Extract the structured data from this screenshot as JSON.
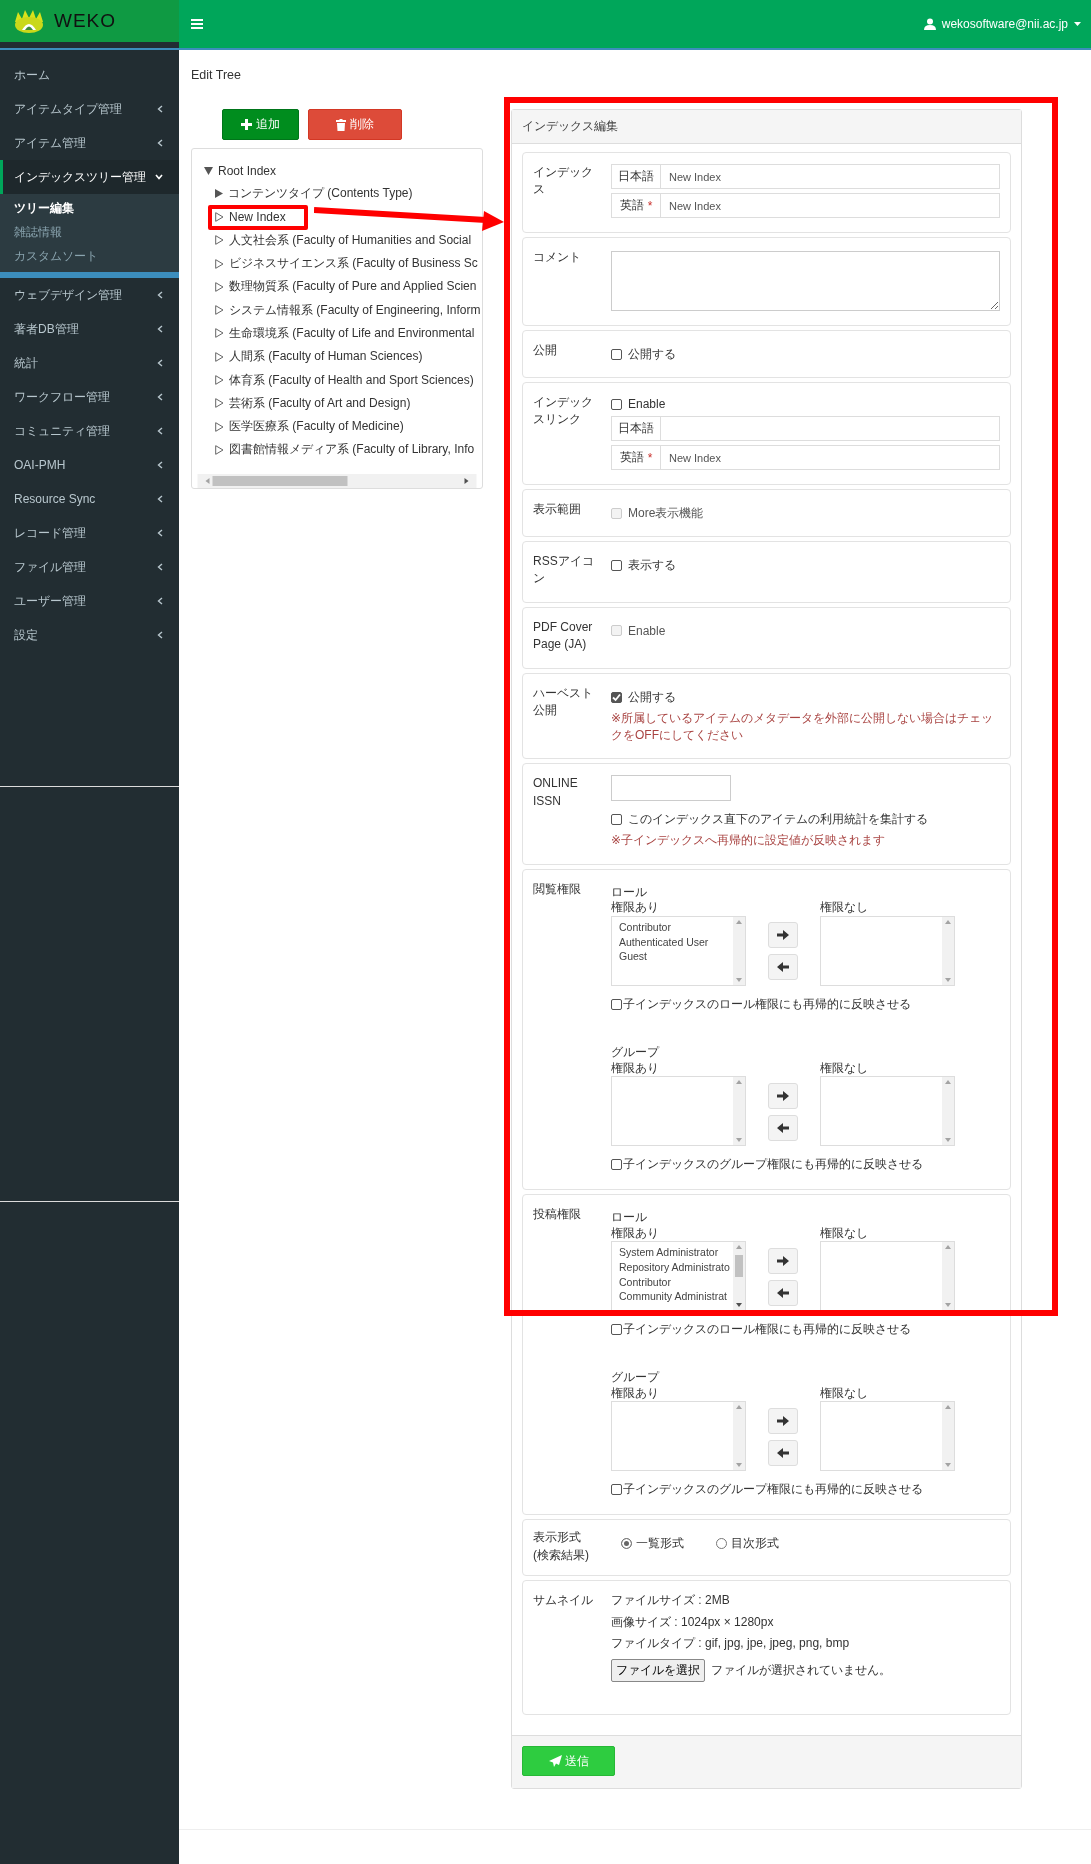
{
  "header": {
    "logo_text": "WEKO",
    "user": "wekosoftware@nii.ac.jp"
  },
  "sidebar": {
    "items": [
      {
        "label": "ホーム",
        "kind": "link"
      },
      {
        "label": "アイテムタイプ管理",
        "kind": "menu",
        "expanded": false
      },
      {
        "label": "アイテム管理",
        "kind": "menu",
        "expanded": false
      },
      {
        "label": "インデックスツリー管理",
        "kind": "menu",
        "expanded": true,
        "children": [
          {
            "label": "ツリー編集",
            "selected": true
          },
          {
            "label": "雑誌情報",
            "selected": false
          },
          {
            "label": "カスタムソート",
            "selected": false
          }
        ]
      },
      {
        "label": "ウェブデザイン管理",
        "kind": "menu",
        "expanded": false
      },
      {
        "label": "著者DB管理",
        "kind": "menu",
        "expanded": false
      },
      {
        "label": "統計",
        "kind": "menu",
        "expanded": false
      },
      {
        "label": "ワークフロー管理",
        "kind": "menu",
        "expanded": false
      },
      {
        "label": "コミュニティ管理",
        "kind": "menu",
        "expanded": false
      },
      {
        "label": "OAI-PMH",
        "kind": "menu",
        "expanded": false
      },
      {
        "label": "Resource Sync",
        "kind": "menu",
        "expanded": false
      },
      {
        "label": "レコード管理",
        "kind": "menu",
        "expanded": false
      },
      {
        "label": "ファイル管理",
        "kind": "menu",
        "expanded": false
      },
      {
        "label": "ユーザー管理",
        "kind": "menu",
        "expanded": false
      },
      {
        "label": "設定",
        "kind": "menu",
        "expanded": false
      }
    ]
  },
  "page_title": "Edit Tree",
  "tree_buttons": [
    {
      "label": "追加",
      "kind": "add"
    },
    {
      "label": "削除",
      "kind": "delete"
    }
  ],
  "tree": {
    "root": {
      "label": "Root Index",
      "expanded": true,
      "children": [
        {
          "label": "コンテンツタイプ (Contents Type)",
          "kind": "folder",
          "highlighted": false
        },
        {
          "label": "New Index",
          "kind": "leaf",
          "highlighted": true
        },
        {
          "label": "人文社会系 (Faculty of Humanities and Social",
          "kind": "leaf",
          "highlighted": false
        },
        {
          "label": "ビジネスサイエンス系 (Faculty of Business Sc",
          "kind": "leaf",
          "highlighted": false
        },
        {
          "label": "数理物質系 (Faculty of Pure and Applied Scien",
          "kind": "leaf",
          "highlighted": false
        },
        {
          "label": "システム情報系 (Faculty of Engineering, Inform",
          "kind": "leaf",
          "highlighted": false
        },
        {
          "label": "生命環境系 (Faculty of Life and Environmental",
          "kind": "leaf",
          "highlighted": false
        },
        {
          "label": "人間系 (Faculty of Human Sciences)",
          "kind": "leaf",
          "highlighted": false
        },
        {
          "label": "体育系 (Faculty of Health and Sport Sciences)",
          "kind": "leaf",
          "highlighted": false
        },
        {
          "label": "芸術系 (Faculty of Art and Design)",
          "kind": "leaf",
          "highlighted": false
        },
        {
          "label": "医学医療系 (Faculty of Medicine)",
          "kind": "leaf",
          "highlighted": false
        },
        {
          "label": "図書館情報メディア系 (Faculty of Library, Info",
          "kind": "leaf",
          "highlighted": false
        }
      ]
    }
  },
  "index_edit": {
    "title": "インデックス編集",
    "highlighted": true,
    "sections": [
      {
        "kind": "names",
        "label": "インデックス",
        "fields": [
          {
            "lang": "日本語",
            "value": "New Index"
          },
          {
            "lang": "英語",
            "required_mark": "*",
            "value": "New Index"
          }
        ]
      },
      {
        "kind": "textarea",
        "label": "コメント"
      },
      {
        "kind": "checkbox",
        "label": "公開",
        "options": [
          {
            "text": "公開する",
            "checked": false,
            "disabled": false
          }
        ]
      },
      {
        "kind": "link",
        "label": "インデックスリンク",
        "option": {
          "text": "Enable",
          "checked": false,
          "disabled": false
        },
        "fields": [
          {
            "lang": "日本語"
          },
          {
            "lang": "英語",
            "required_mark": "*",
            "value": "New Index"
          }
        ]
      },
      {
        "kind": "checkbox",
        "label": "表示範囲",
        "options": [
          {
            "text": "More表示機能",
            "checked": false,
            "disabled": true
          }
        ]
      },
      {
        "kind": "checkbox",
        "label": "RSSアイコン",
        "options": [
          {
            "text": "表示する",
            "checked": false,
            "disabled": false
          }
        ]
      },
      {
        "kind": "checkbox",
        "label": "PDF Cover Page (JA)",
        "options": [
          {
            "text": "Enable",
            "checked": false,
            "disabled": true
          }
        ]
      },
      {
        "kind": "checkbox",
        "label": "ハーベスト公開",
        "options": [
          {
            "text": "公開する",
            "checked": true,
            "disabled": false
          }
        ],
        "note": "※所属しているアイテムのメタデータを外部に公開しない場合はチェックをOFFにしてください"
      },
      {
        "kind": "issn",
        "label": "ONLINE ISSN",
        "option": {
          "text": "このインデックス直下のアイテムの利用統計を集計する",
          "checked": false,
          "disabled": false
        },
        "note": "※子インデックスへ再帰的に設定値が反映されます"
      },
      {
        "kind": "permissions",
        "label": "閲覧権限",
        "groups": [
          {
            "title": "ロール",
            "allowed_label": "権限あり",
            "denied_label": "権限なし",
            "allowed": [
              "Contributor",
              "Authenticated User",
              "Guest"
            ],
            "recursive": {
              "text": "子インデックスのロール権限にも再帰的に反映させる",
              "checked": false,
              "disabled": false
            }
          },
          {
            "title": "グループ",
            "allowed_label": "権限あり",
            "denied_label": "権限なし",
            "recursive": {
              "text": "子インデックスのグループ権限にも再帰的に反映させる",
              "checked": false,
              "disabled": false
            }
          }
        ]
      },
      {
        "kind": "permissions",
        "label": "投稿権限",
        "groups": [
          {
            "title": "ロール",
            "allowed_label": "権限あり",
            "denied_label": "権限なし",
            "allowed": [
              "System Administrator",
              "Repository Administrato",
              "Contributor",
              "Community Administrat"
            ],
            "recursive": {
              "text": "子インデックスのロール権限にも再帰的に反映させる",
              "checked": false,
              "disabled": false
            }
          },
          {
            "title": "グループ",
            "allowed_label": "権限あり",
            "denied_label": "権限なし",
            "recursive": {
              "text": "子インデックスのグループ権限にも再帰的に反映させる",
              "checked": false,
              "disabled": false
            }
          }
        ]
      },
      {
        "kind": "radio",
        "label": "表示形式 (検索結果)",
        "options": [
          {
            "text": "一覧形式",
            "selected": true
          },
          {
            "text": "目次形式",
            "selected": false
          }
        ]
      },
      {
        "kind": "thumbnail",
        "label": "サムネイル",
        "lines": [
          "ファイルサイズ : 2MB",
          "画像サイズ : 1024px × 1280px",
          "ファイルタイプ : gif, jpg, jpe, jpeg, png, bmp"
        ],
        "file_button": "ファイルを選択",
        "file_status": "ファイルが選択されていません。"
      }
    ],
    "submit": "送信"
  }
}
